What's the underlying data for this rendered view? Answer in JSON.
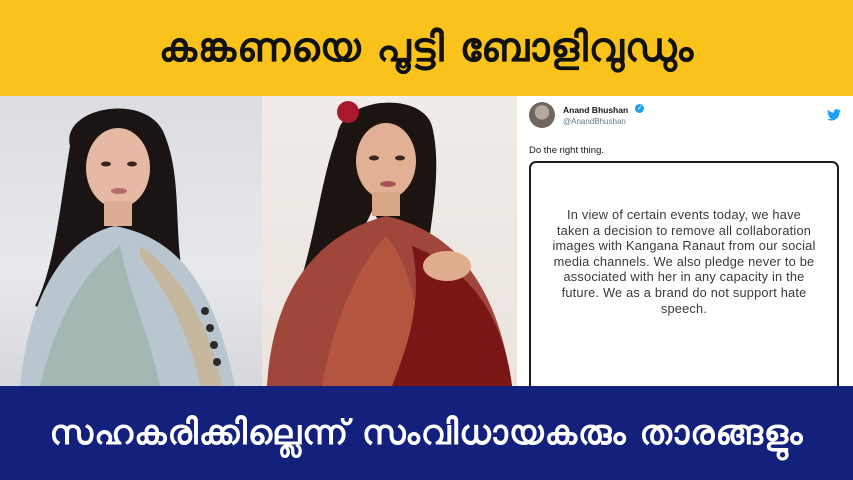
{
  "headline_top": "കങ്കണയെ പൂട്ടി ബോളിവുഡും",
  "headline_bottom": "സഹകരിക്കില്ലെന്ന് സംവിധായകരും താരങ്ങളും",
  "tweet": {
    "display_name": "Anand Bhushan",
    "handle": "@AnandBhushan",
    "text": "Do the right thing.",
    "statement": "In view of certain events today, we have taken a decision to remove all collaboration images with Kangana Ranaut from our social media channels. We also pledge never to be associated with her in any capacity in the future. We as a brand do not support hate speech."
  },
  "colors": {
    "top_banner": "#f9c31b",
    "bottom_banner": "#13207c",
    "twitter_blue": "#1da1f2"
  },
  "icons": {
    "verified": "verified-badge-icon",
    "twitter": "twitter-bird-icon"
  }
}
